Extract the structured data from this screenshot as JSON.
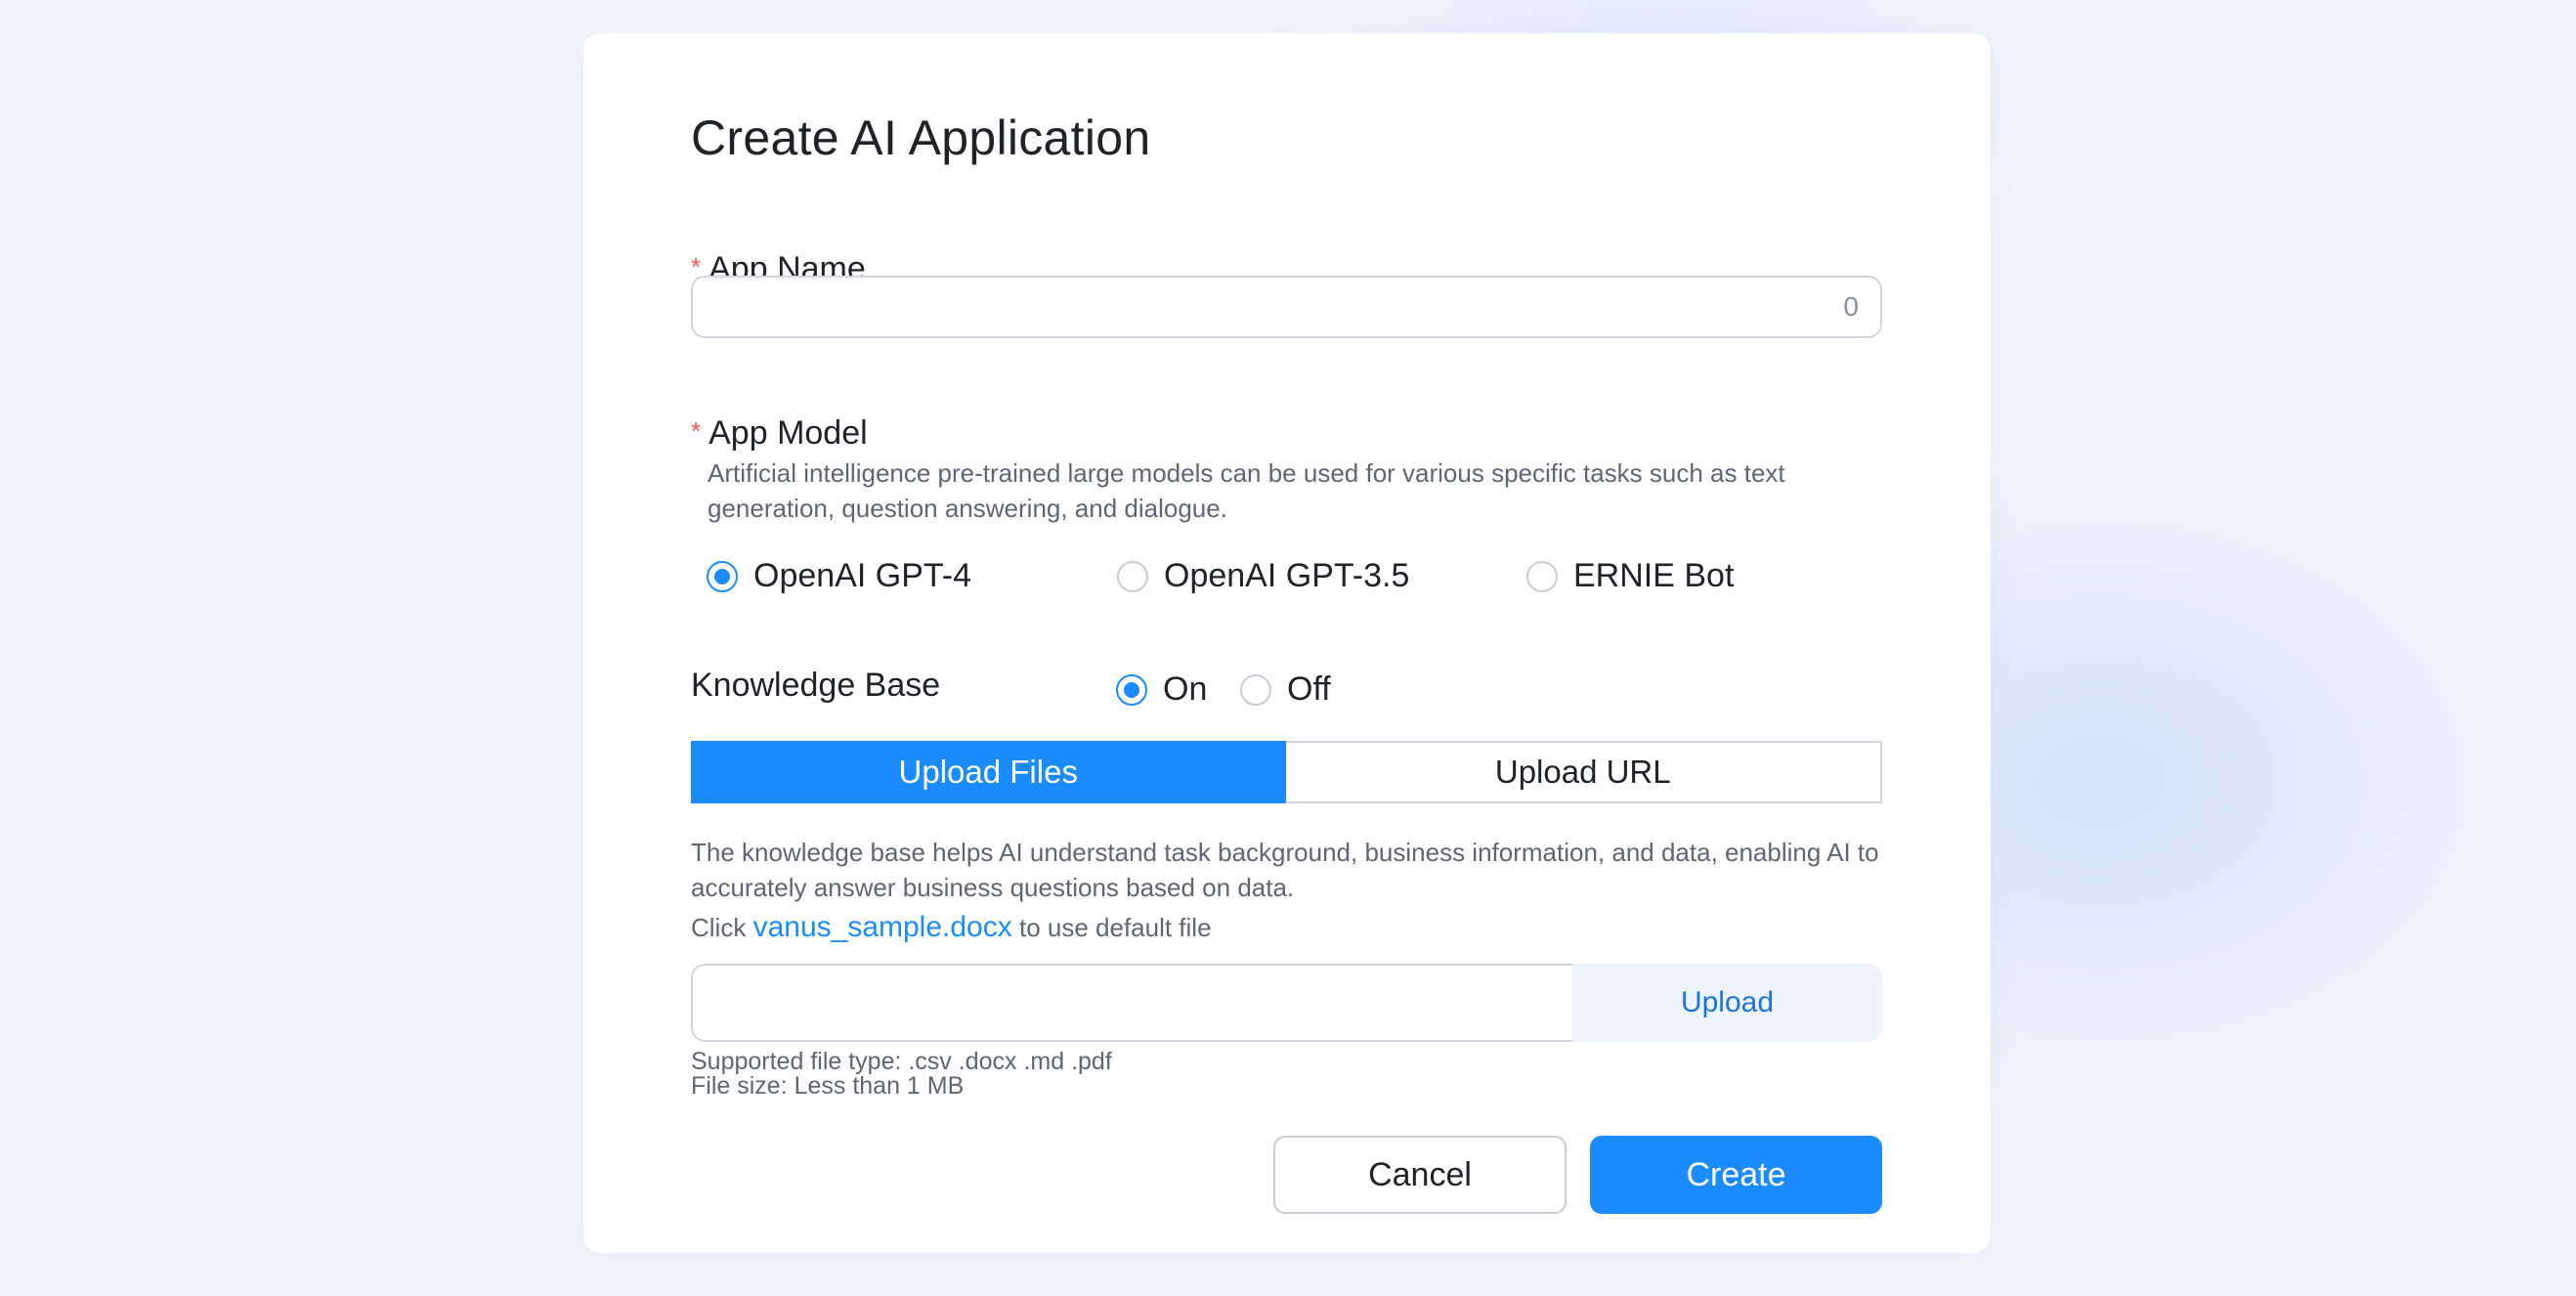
{
  "dialog": {
    "title": "Create AI Application",
    "app_name": {
      "label": "App Name",
      "required_mark": "*",
      "value": "",
      "char_count": "0"
    },
    "app_model": {
      "label": "App Model",
      "required_mark": "*",
      "description": "Artificial intelligence pre-trained large models can be used for various specific tasks such as text generation, question answering, and dialogue.",
      "options": [
        {
          "label": "OpenAI GPT-4",
          "selected": true
        },
        {
          "label": "OpenAI GPT-3.5",
          "selected": false
        },
        {
          "label": "ERNIE Bot",
          "selected": false
        }
      ]
    },
    "knowledge_base": {
      "label": "Knowledge Base",
      "options": [
        {
          "label": "On",
          "selected": true
        },
        {
          "label": "Off",
          "selected": false
        }
      ],
      "tabs": [
        {
          "label": "Upload Files",
          "active": true
        },
        {
          "label": "Upload URL",
          "active": false
        }
      ],
      "description": "The knowledge base helps AI understand task background, business information, and data, enabling AI to accurately answer business questions based on data.",
      "default_file": {
        "prefix": "Click",
        "link": "vanus_sample.docx",
        "suffix": "to use default file"
      },
      "upload_button": "Upload",
      "supported_types": "Supported file type: .csv .docx .md .pdf",
      "file_size": "File size: Less than 1 MB"
    },
    "actions": {
      "cancel": "Cancel",
      "create": "Create"
    }
  },
  "colors": {
    "accent": "#1a8cff",
    "required": "#f0584e",
    "upload_bg": "#eef4fe"
  }
}
